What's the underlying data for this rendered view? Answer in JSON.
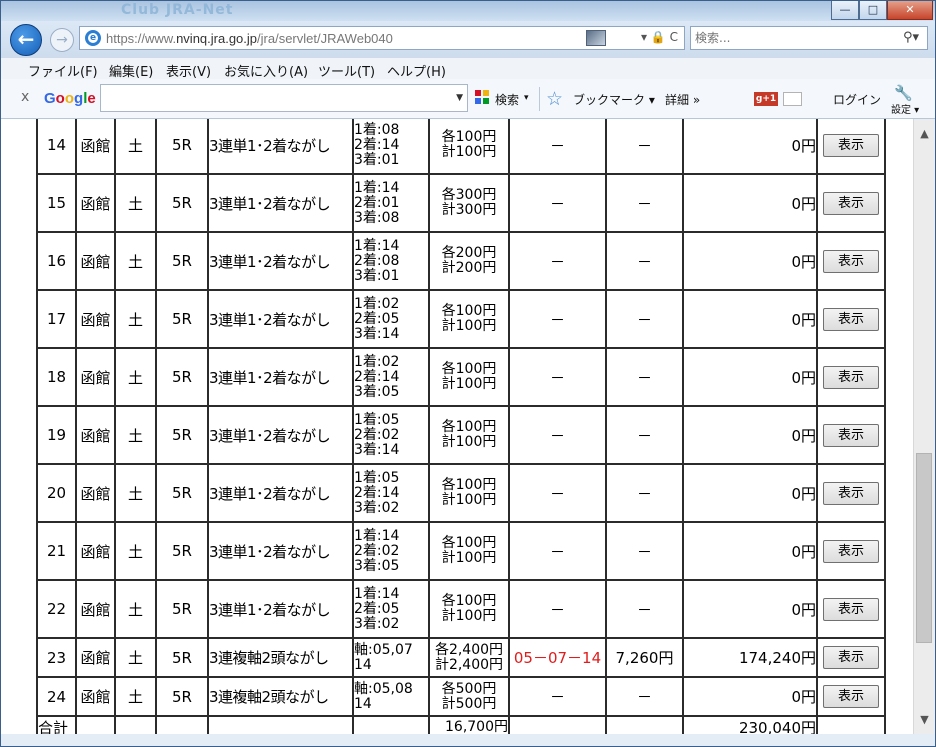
{
  "window": {
    "ghost_title": "Club JRA-Net",
    "minimize": "—",
    "maximize": "□",
    "close": "✕"
  },
  "address": {
    "url_prefix": "https://www.",
    "url_main": "nvinq.jra.go.jp",
    "url_rest": "/jra/servlet/JRAWeb040",
    "tools": "▾ 🔒 C"
  },
  "search": {
    "placeholder": "検索..."
  },
  "menu": [
    {
      "label": "ファイル(F)"
    },
    {
      "label": "編集(E)"
    },
    {
      "label": "表示(V)"
    },
    {
      "label": "お気に入り(A)"
    },
    {
      "label": "ツール(T)"
    },
    {
      "label": "ヘルプ(H)"
    }
  ],
  "google_bar": {
    "close": "x",
    "logo": "Google",
    "search_label": "検索",
    "bookmarks_label": "ブックマーク",
    "detail_label": "詳細 »",
    "gplus": "+1",
    "login_label": "ログイン",
    "settings_label": "設定"
  },
  "table": {
    "rows": [
      {
        "no": "14",
        "place": "函館",
        "day": "土",
        "race": "5R",
        "type": "3連単1･2着ながし",
        "combo": [
          "1着:08",
          "2着:14",
          "3着:01"
        ],
        "amount": [
          "各100円",
          "計100円"
        ],
        "hit": "－",
        "payout": "－",
        "total": "0円",
        "button": "表示"
      },
      {
        "no": "15",
        "place": "函館",
        "day": "土",
        "race": "5R",
        "type": "3連単1･2着ながし",
        "combo": [
          "1着:14",
          "2着:01",
          "3着:08"
        ],
        "amount": [
          "各300円",
          "計300円"
        ],
        "hit": "－",
        "payout": "－",
        "total": "0円",
        "button": "表示"
      },
      {
        "no": "16",
        "place": "函館",
        "day": "土",
        "race": "5R",
        "type": "3連単1･2着ながし",
        "combo": [
          "1着:14",
          "2着:08",
          "3着:01"
        ],
        "amount": [
          "各200円",
          "計200円"
        ],
        "hit": "－",
        "payout": "－",
        "total": "0円",
        "button": "表示"
      },
      {
        "no": "17",
        "place": "函館",
        "day": "土",
        "race": "5R",
        "type": "3連単1･2着ながし",
        "combo": [
          "1着:02",
          "2着:05",
          "3着:14"
        ],
        "amount": [
          "各100円",
          "計100円"
        ],
        "hit": "－",
        "payout": "－",
        "total": "0円",
        "button": "表示"
      },
      {
        "no": "18",
        "place": "函館",
        "day": "土",
        "race": "5R",
        "type": "3連単1･2着ながし",
        "combo": [
          "1着:02",
          "2着:14",
          "3着:05"
        ],
        "amount": [
          "各100円",
          "計100円"
        ],
        "hit": "－",
        "payout": "－",
        "total": "0円",
        "button": "表示"
      },
      {
        "no": "19",
        "place": "函館",
        "day": "土",
        "race": "5R",
        "type": "3連単1･2着ながし",
        "combo": [
          "1着:05",
          "2着:02",
          "3着:14"
        ],
        "amount": [
          "各100円",
          "計100円"
        ],
        "hit": "－",
        "payout": "－",
        "total": "0円",
        "button": "表示"
      },
      {
        "no": "20",
        "place": "函館",
        "day": "土",
        "race": "5R",
        "type": "3連単1･2着ながし",
        "combo": [
          "1着:05",
          "2着:14",
          "3着:02"
        ],
        "amount": [
          "各100円",
          "計100円"
        ],
        "hit": "－",
        "payout": "－",
        "total": "0円",
        "button": "表示"
      },
      {
        "no": "21",
        "place": "函館",
        "day": "土",
        "race": "5R",
        "type": "3連単1･2着ながし",
        "combo": [
          "1着:14",
          "2着:02",
          "3着:05"
        ],
        "amount": [
          "各100円",
          "計100円"
        ],
        "hit": "－",
        "payout": "－",
        "total": "0円",
        "button": "表示"
      },
      {
        "no": "22",
        "place": "函館",
        "day": "土",
        "race": "5R",
        "type": "3連単1･2着ながし",
        "combo": [
          "1着:14",
          "2着:05",
          "3着:02"
        ],
        "amount": [
          "各100円",
          "計100円"
        ],
        "hit": "－",
        "payout": "－",
        "total": "0円",
        "button": "表示"
      },
      {
        "no": "23",
        "place": "函館",
        "day": "土",
        "race": "5R",
        "type": "3連複軸2頭ながし",
        "combo": [
          "軸:05,07",
          "14"
        ],
        "amount": [
          "各2,400円",
          "計2,400円"
        ],
        "hit": "05－07－14",
        "hit_color": "#e01c1c",
        "payout": "7,260円",
        "total": "174,240円",
        "button": "表示"
      },
      {
        "no": "24",
        "place": "函館",
        "day": "土",
        "race": "5R",
        "type": "3連複軸2頭ながし",
        "combo": [
          "軸:05,08",
          "14"
        ],
        "amount": [
          "各500円",
          "計500円"
        ],
        "hit": "－",
        "payout": "－",
        "total": "0円",
        "button": "表示"
      }
    ],
    "summary": {
      "label": "合計",
      "amount": "16,700円",
      "total": "230,040円"
    }
  }
}
